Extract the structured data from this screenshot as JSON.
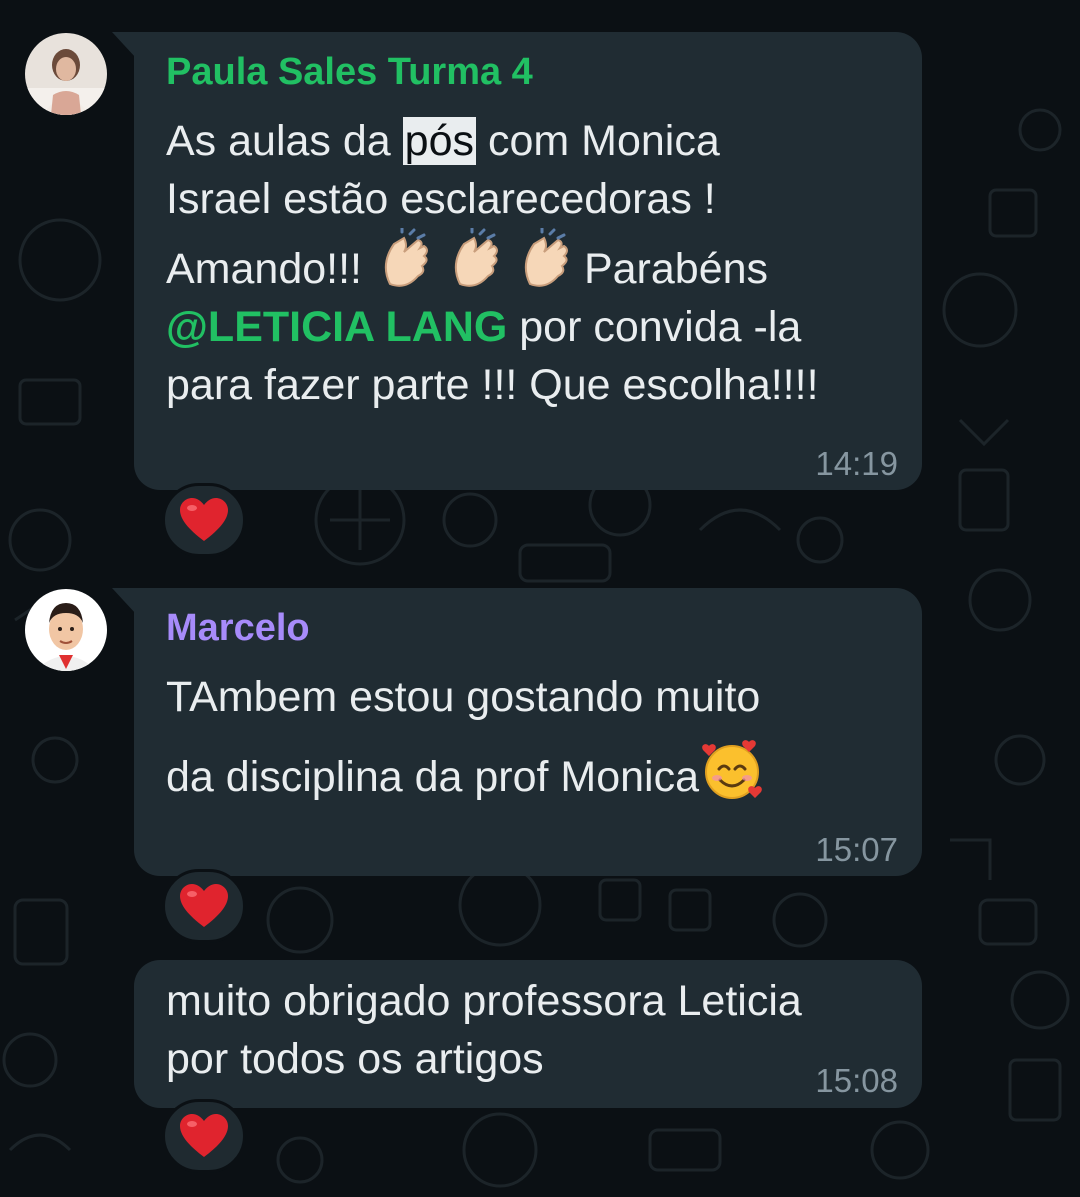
{
  "messages": [
    {
      "sender": "Paula Sales Turma 4",
      "sender_color": "#21c063",
      "lines": {
        "l1_before": "As aulas da ",
        "l1_highlight": "pós",
        "l1_after": " com Monica",
        "l2": "Israel estão esclarecedoras !",
        "l3_before": "Amando!!! ",
        "l3_after": "Parabéns",
        "l4_mention": "@LETICIA LANG",
        "l4_after": " por convida -la",
        "l5": "para fazer parte !!! Que escolha!!!!"
      },
      "emojis": [
        "clapping-hands",
        "clapping-hands",
        "clapping-hands"
      ],
      "time": "14:19",
      "reaction": "red-heart"
    },
    {
      "sender": "Marcelo",
      "sender_color": "#a78bfa",
      "lines": {
        "l1": "TAmbem estou gostando muito",
        "l2": "da disciplina da prof Monica"
      },
      "emojis": [
        "smiling-face-with-hearts"
      ],
      "time": "15:07",
      "reaction": "red-heart"
    },
    {
      "lines": {
        "l1": "muito obrigado professora Leticia",
        "l2": "por todos os artigos"
      },
      "time": "15:08",
      "reaction": "red-heart"
    }
  ],
  "colors": {
    "background": "#0b1014",
    "bubble": "#202c33",
    "text": "#e9edef",
    "timestamp": "#8696a0",
    "mention": "#21c063"
  }
}
